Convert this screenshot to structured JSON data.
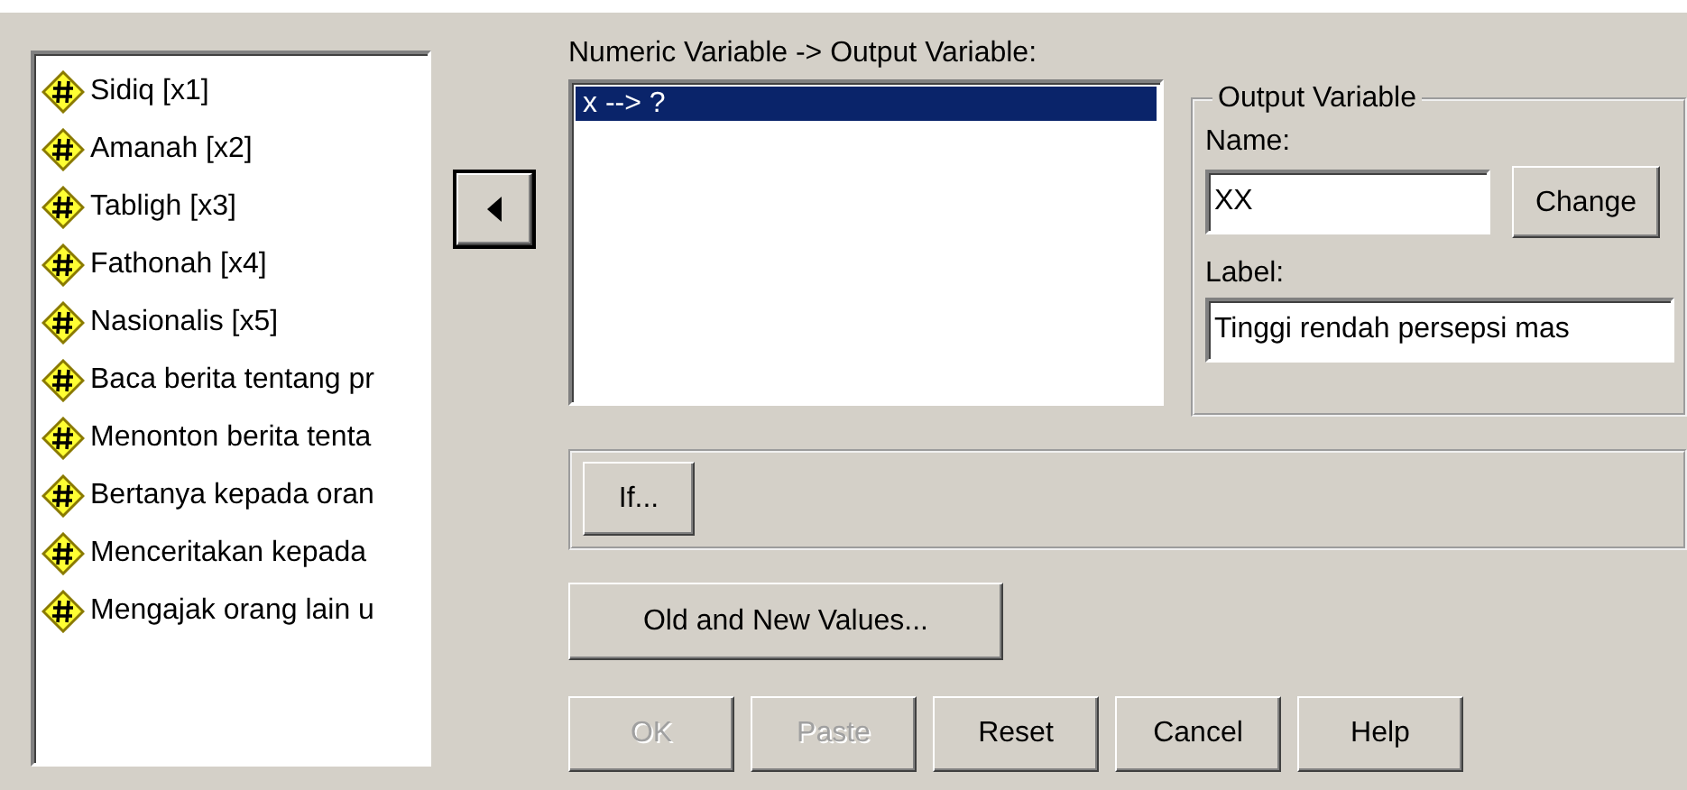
{
  "source_list": {
    "items": [
      {
        "label": "Sidiq [x1]"
      },
      {
        "label": "Amanah [x2]"
      },
      {
        "label": "Tabligh [x3]"
      },
      {
        "label": "Fathonah [x4]"
      },
      {
        "label": "Nasionalis [x5]"
      },
      {
        "label": "Baca berita tentang pr"
      },
      {
        "label": "Menonton berita tenta"
      },
      {
        "label": "Bertanya kepada oran"
      },
      {
        "label": "Menceritakan kepada"
      },
      {
        "label": "Mengajak orang lain u"
      }
    ]
  },
  "mapping": {
    "label": "Numeric Variable -> Output Variable:",
    "items": [
      {
        "label": "x --> ?",
        "selected": true
      }
    ]
  },
  "output_variable": {
    "title": "Output Variable",
    "name_label": "Name:",
    "name_value": "XX",
    "change_button": "Change",
    "label_label": "Label:",
    "label_value": "Tinggi rendah persepsi mas"
  },
  "if_button": "If...",
  "old_new_button": "Old and New Values...",
  "buttons": [
    {
      "label": "OK",
      "disabled": true
    },
    {
      "label": "Paste",
      "disabled": true
    },
    {
      "label": "Reset",
      "disabled": false
    },
    {
      "label": "Cancel",
      "disabled": false
    },
    {
      "label": "Help",
      "disabled": false
    }
  ]
}
